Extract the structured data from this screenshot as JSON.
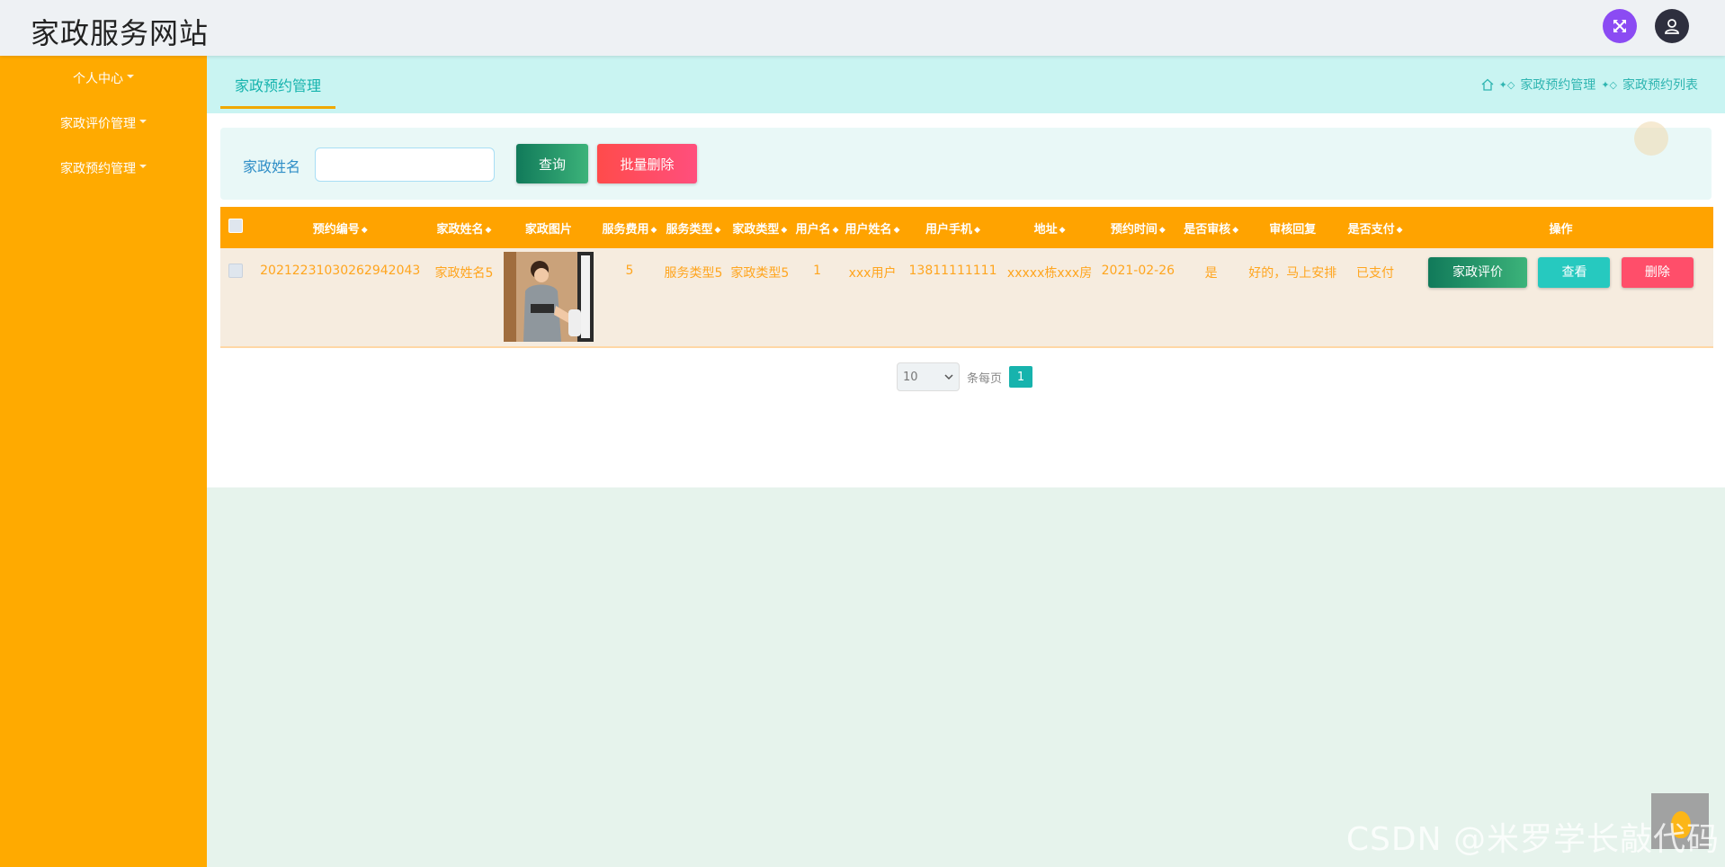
{
  "header": {
    "site_title": "家政服务网站",
    "expand_icon": "expand-arrows-icon",
    "user_icon": "user-icon"
  },
  "sidebar": {
    "items": [
      {
        "label": "个人中心"
      },
      {
        "label": "家政评价管理"
      },
      {
        "label": "家政预约管理"
      }
    ]
  },
  "tabs": {
    "active": "家政预约管理"
  },
  "breadcrumb": {
    "home_icon": "home-icon",
    "level1": "家政预约管理",
    "level2": "家政预约列表"
  },
  "search": {
    "label": "家政姓名",
    "placeholder": "",
    "value": "",
    "query_label": "查询",
    "batch_delete_label": "批量删除"
  },
  "table": {
    "columns": [
      "预约编号",
      "家政姓名",
      "家政图片",
      "服务费用",
      "服务类型",
      "家政类型",
      "用户名",
      "用户姓名",
      "用户手机",
      "地址",
      "预约时间",
      "是否审核",
      "审核回复",
      "是否支付",
      "操作"
    ],
    "sortable": [
      true,
      true,
      false,
      true,
      true,
      true,
      true,
      true,
      true,
      true,
      true,
      true,
      false,
      true,
      false
    ],
    "rows": [
      {
        "booking_no": "20212231030262942043",
        "staff_name": "家政姓名5",
        "fee": "5",
        "service_type": "服务类型5",
        "staff_type": "家政类型5",
        "username": "1",
        "user_realname": "xxx用户",
        "phone": "13811111111",
        "address": "xxxxx栋xxx房",
        "booking_time": "2021-02-26",
        "reviewed": "是",
        "review_reply": "好的，马上安排",
        "paid": "已支付",
        "actions": {
          "review": "家政评价",
          "view": "查看",
          "delete": "删除"
        }
      }
    ]
  },
  "pagination": {
    "page_size": "10",
    "per_page_label": "条每页",
    "current_page": "1"
  },
  "watermark": "CSDN @米罗学长敲代码",
  "colors": {
    "sidebar": "#ffaa00",
    "table_header": "#ffa300",
    "accent_teal": "#17b3ad",
    "row_bg": "#f6ecdf"
  }
}
